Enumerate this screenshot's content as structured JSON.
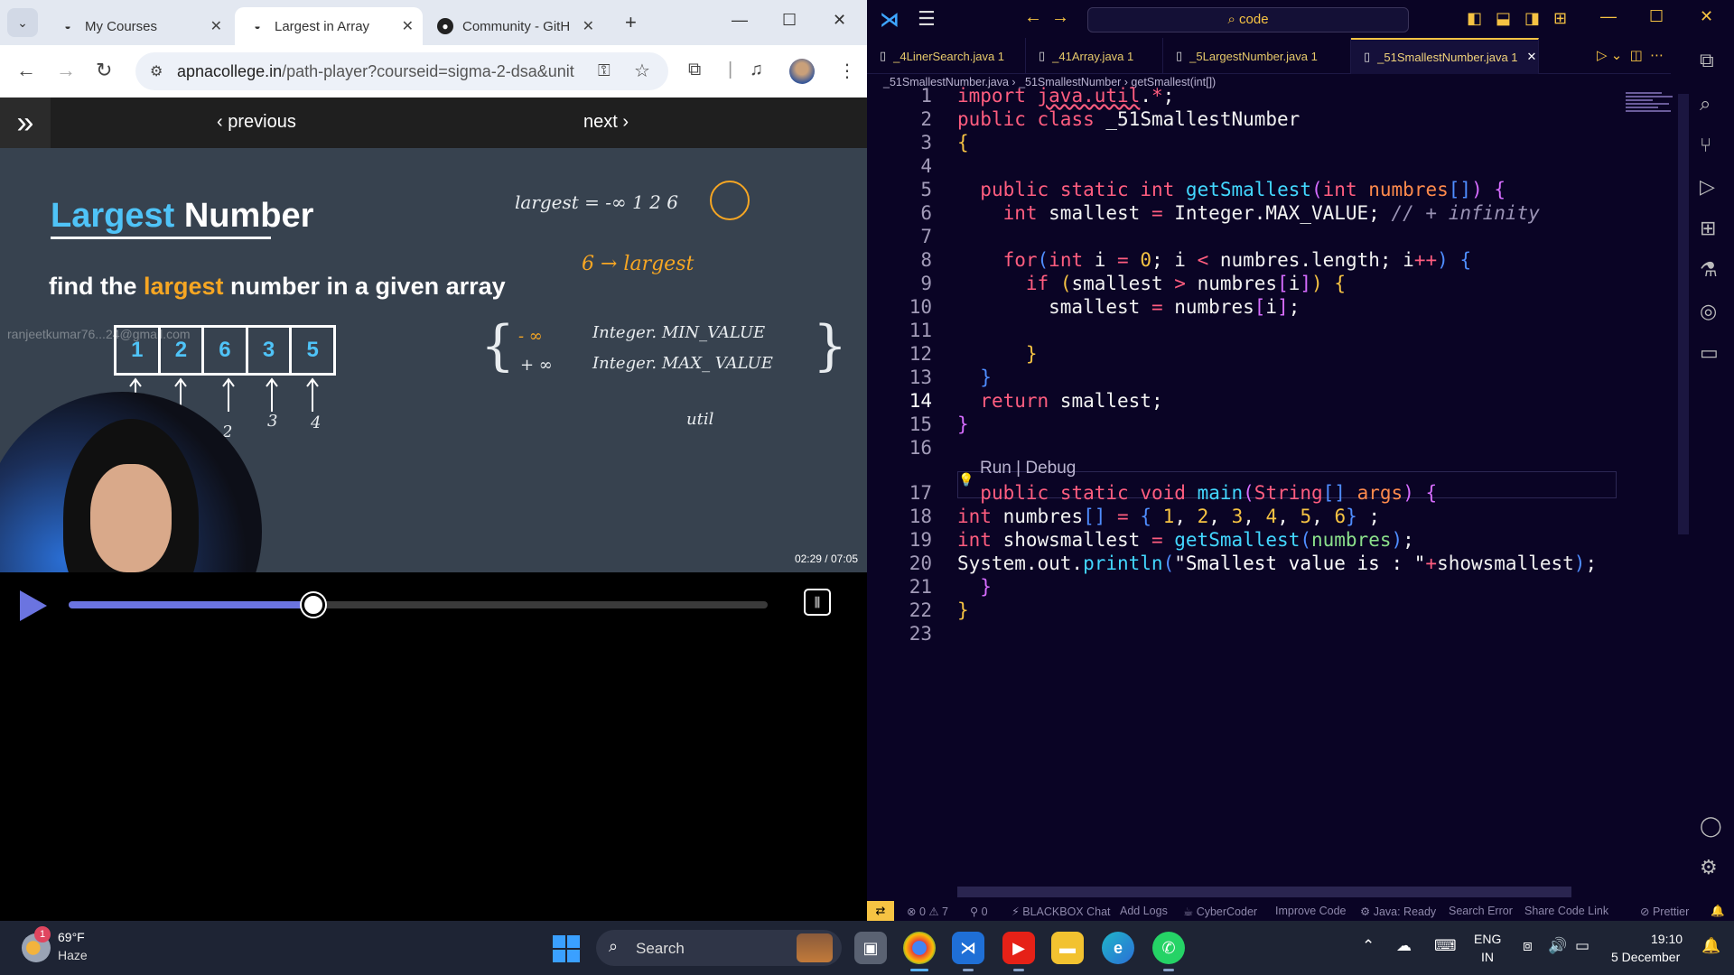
{
  "browser": {
    "tabs": [
      {
        "label": "My Courses"
      },
      {
        "label": "Largest in Array"
      },
      {
        "label": "Community - GitH"
      }
    ],
    "url_host": "apnacollege.in",
    "url_path": "/path-player?courseid=sigma-2-dsa&unit...",
    "player": {
      "previous": "previous",
      "next": "next"
    },
    "video": {
      "title_a": "Largest",
      "title_b": " Number",
      "sub_a": "find the ",
      "sub_b": "largest",
      "sub_c": " number in a given array",
      "array": [
        "1",
        "2",
        "6",
        "3",
        "5"
      ],
      "indices": [
        "2",
        "3",
        "4"
      ],
      "watermark": "ranjeetkumar76...24@gmail.com",
      "note_largest": "largest = -∞ 1 2 6",
      "note_six": "6 → largest",
      "note_neg": "- ∞",
      "note_pos": "+ ∞",
      "note_min": "Integer. MIN_VALUE",
      "note_max": "Integer. MAX_ VALUE",
      "note_util": "util",
      "timecode": "02:29 / 07:05",
      "progress": 0.35
    }
  },
  "vscode": {
    "command_center": "code",
    "tabs": [
      {
        "label": "_4LinerSearch.java 1"
      },
      {
        "label": "_41Array.java 1"
      },
      {
        "label": "_5LargestNumber.java 1"
      },
      {
        "label": "_51SmallestNumber.java 1"
      }
    ],
    "breadcrumb": "_51SmallestNumber.java  ›  _51SmallestNumber  ›  getSmallest(int[])",
    "line_numbers": [
      "1",
      "2",
      "3",
      "4",
      "5",
      "6",
      "7",
      "8",
      "9",
      "10",
      "11",
      "12",
      "13",
      "14",
      "15",
      "16",
      "17",
      "18",
      "19",
      "20",
      "21",
      "22",
      "23"
    ],
    "codelens": "Run | Debug",
    "status": {
      "problems": "0 ⚠ 7",
      "ports": "0",
      "blackbox": "BLACKBOX Chat",
      "addlogs": "Add Logs",
      "cybercoder": "CyberCoder",
      "improve": "Improve Code",
      "java": "Java: Ready",
      "searcherror": "Search Error",
      "share": "Share Code Link",
      "prettier": "Prettier"
    }
  },
  "taskbar": {
    "badge": "1",
    "temp": "69°F",
    "weather": "Haze",
    "search": "Search",
    "lang1": "ENG",
    "lang2": "IN",
    "time": "19:10",
    "date": "5 December"
  }
}
